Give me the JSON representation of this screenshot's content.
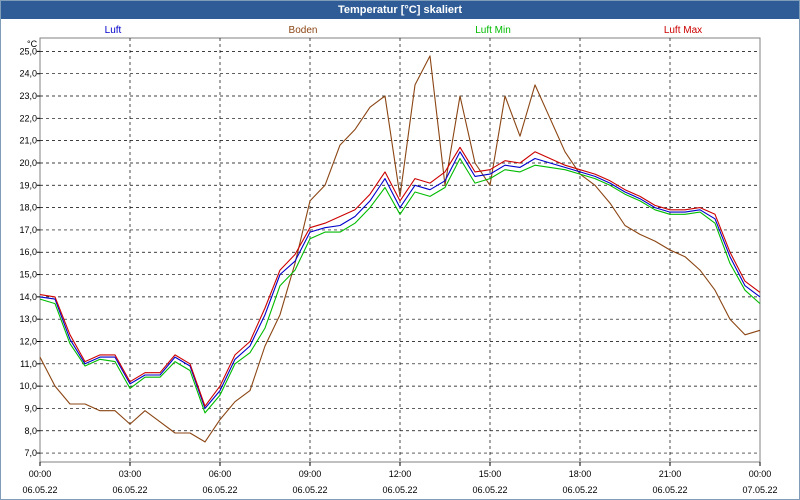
{
  "window": {
    "title": "Temperatur [°C] skaliert"
  },
  "chart_data": {
    "type": "line",
    "title": "Temperatur [°C] skaliert",
    "ylabel": "°C",
    "ylim": [
      6.6,
      25.6
    ],
    "grid": true,
    "legend_placement": "top",
    "yticks": [
      "7,0",
      "8,0",
      "9,0",
      "10,0",
      "11,0",
      "12,0",
      "13,0",
      "14,0",
      "15,0",
      "16,0",
      "17,0",
      "18,0",
      "19,0",
      "20,0",
      "21,0",
      "22,0",
      "23,0",
      "24,0",
      "25,0"
    ],
    "xticks": [
      {
        "time": "00:00",
        "date": "06.05.22"
      },
      {
        "time": "03:00",
        "date": "06.05.22"
      },
      {
        "time": "06:00",
        "date": "06.05.22"
      },
      {
        "time": "09:00",
        "date": "06.05.22"
      },
      {
        "time": "12:00",
        "date": "06.05.22"
      },
      {
        "time": "15:00",
        "date": "06.05.22"
      },
      {
        "time": "18:00",
        "date": "06.05.22"
      },
      {
        "time": "21:00",
        "date": "06.05.22"
      },
      {
        "time": "00:00",
        "date": "07.05.22"
      }
    ],
    "x_hours": [
      0,
      0.5,
      1,
      1.5,
      2,
      2.5,
      3,
      3.5,
      4,
      4.5,
      5,
      5.5,
      6,
      6.5,
      7,
      7.5,
      8,
      8.5,
      9,
      9.5,
      10,
      10.5,
      11,
      11.5,
      12,
      12.5,
      13,
      13.5,
      14,
      14.5,
      15,
      15.5,
      16,
      16.5,
      17,
      17.5,
      18,
      18.5,
      19,
      19.5,
      20,
      20.5,
      21,
      21.5,
      22,
      22.5,
      23,
      23.5,
      24
    ],
    "series": [
      {
        "name": "Luft",
        "color": "#0000cc",
        "values": [
          14.0,
          13.9,
          12.1,
          11.0,
          11.3,
          11.3,
          10.1,
          10.5,
          10.5,
          11.3,
          10.9,
          9.0,
          9.8,
          11.2,
          11.8,
          13.2,
          15.0,
          15.6,
          16.9,
          17.1,
          17.2,
          17.6,
          18.3,
          19.3,
          18.0,
          19.0,
          18.8,
          19.2,
          20.5,
          19.4,
          19.5,
          19.9,
          19.8,
          20.2,
          20.0,
          19.8,
          19.6,
          19.4,
          19.1,
          18.7,
          18.4,
          18.0,
          17.8,
          17.8,
          17.9,
          17.5,
          15.8,
          14.5,
          14.0
        ]
      },
      {
        "name": "Boden",
        "color": "#8b4513",
        "values": [
          11.3,
          10.0,
          9.2,
          9.2,
          8.9,
          8.9,
          8.3,
          8.9,
          8.4,
          7.9,
          7.9,
          7.5,
          8.5,
          9.3,
          9.8,
          11.8,
          13.2,
          15.5,
          18.3,
          19.0,
          20.8,
          21.5,
          22.5,
          23.0,
          18.5,
          23.5,
          24.8,
          19.0,
          23.0,
          20.0,
          19.0,
          23.0,
          21.2,
          23.5,
          22.0,
          20.5,
          19.5,
          19.0,
          18.2,
          17.2,
          16.8,
          16.5,
          16.1,
          15.8,
          15.2,
          14.3,
          13.0,
          12.3,
          12.5
        ]
      },
      {
        "name": "Luft Min",
        "color": "#00bb00",
        "values": [
          13.9,
          13.7,
          11.9,
          10.9,
          11.2,
          11.1,
          9.9,
          10.4,
          10.4,
          11.1,
          10.7,
          8.8,
          9.6,
          11.0,
          11.5,
          12.6,
          14.5,
          15.2,
          16.6,
          16.9,
          16.9,
          17.3,
          18.0,
          18.9,
          17.7,
          18.7,
          18.5,
          18.9,
          20.2,
          19.1,
          19.3,
          19.7,
          19.6,
          19.9,
          19.8,
          19.7,
          19.5,
          19.3,
          19.0,
          18.6,
          18.3,
          17.9,
          17.7,
          17.7,
          17.8,
          17.3,
          15.5,
          14.3,
          13.7
        ]
      },
      {
        "name": "Luft Max",
        "color": "#cc0000",
        "values": [
          14.1,
          14.0,
          12.3,
          11.1,
          11.4,
          11.4,
          10.2,
          10.6,
          10.6,
          11.4,
          11.0,
          9.1,
          10.0,
          11.4,
          12.0,
          13.5,
          15.2,
          15.9,
          17.1,
          17.3,
          17.6,
          17.9,
          18.6,
          19.6,
          18.3,
          19.3,
          19.1,
          19.6,
          20.7,
          19.6,
          19.7,
          20.1,
          20.0,
          20.5,
          20.2,
          19.9,
          19.7,
          19.5,
          19.2,
          18.8,
          18.5,
          18.1,
          17.9,
          17.9,
          18.0,
          17.7,
          16.0,
          14.7,
          14.2
        ]
      }
    ]
  }
}
